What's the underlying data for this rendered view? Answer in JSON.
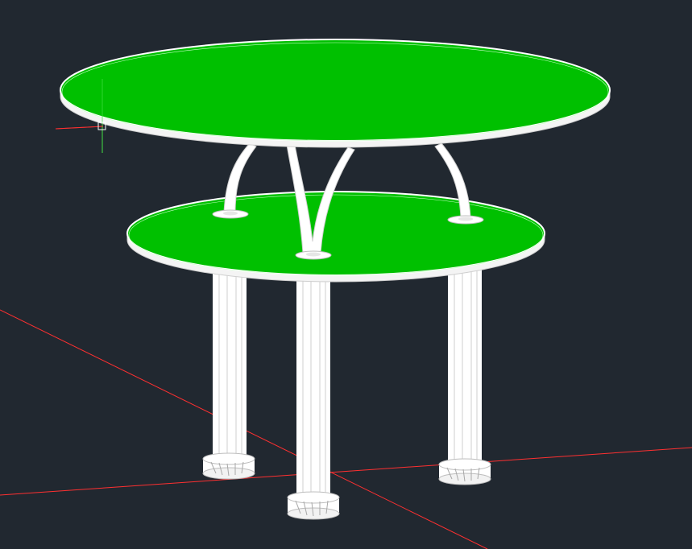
{
  "viewport": {
    "background_color": "#212830",
    "visual_style": "wireframe-shaded"
  },
  "model": {
    "tabletop_color": "#00c000",
    "tabletop_edge_color": "#ffffff",
    "leg_color": "#ffffff",
    "leg_shade_color": "#d9d9d9"
  },
  "axes": {
    "x_axis_color": "#ff3030",
    "ucs_icon_color": "#43e043"
  },
  "cursor": {
    "crosshair_x_color": "#ff3030",
    "crosshair_y_color": "#43e043",
    "pickbox_color": "#ffffff"
  }
}
